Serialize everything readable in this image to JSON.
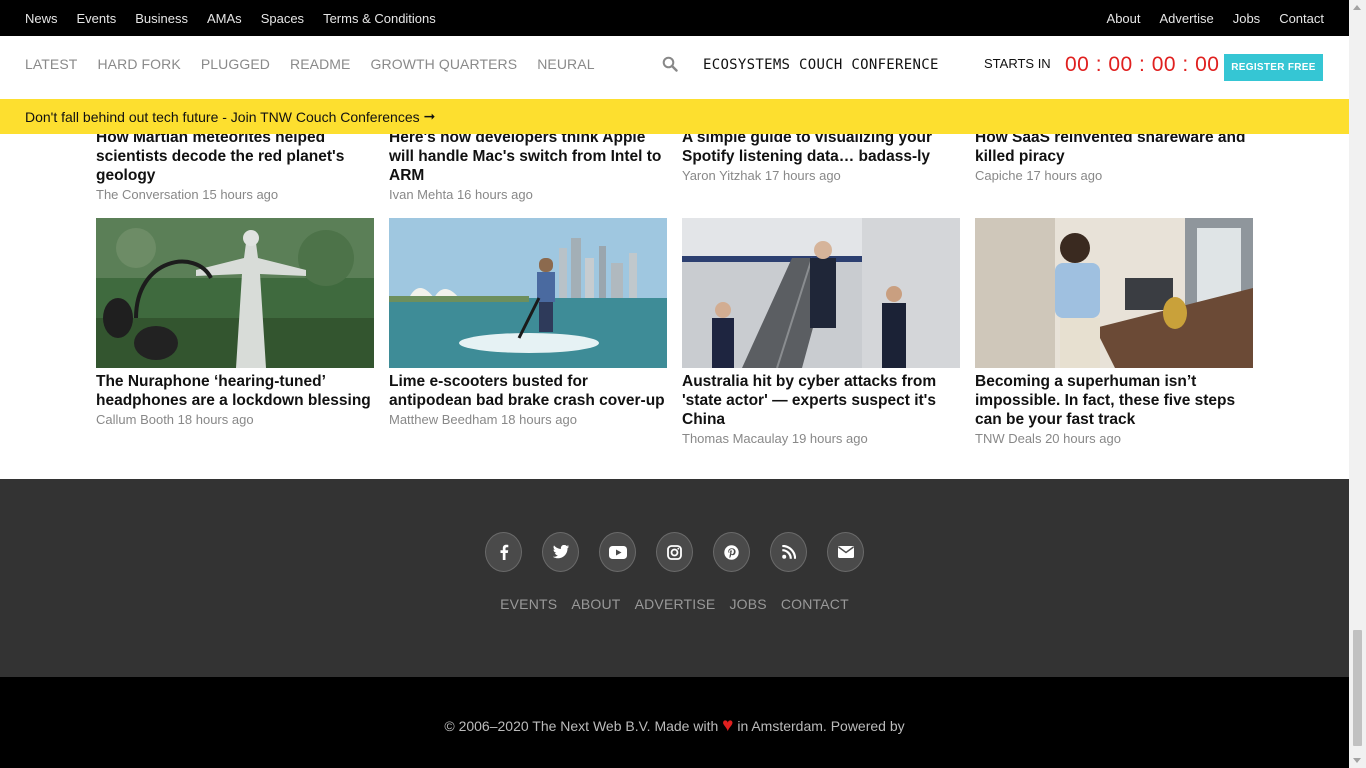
{
  "topbar": {
    "left": [
      "News",
      "Events",
      "Business",
      "AMAs",
      "Spaces",
      "Terms & Conditions"
    ],
    "right": [
      "About",
      "Advertise",
      "Jobs",
      "Contact"
    ]
  },
  "navbar": {
    "categories": [
      "LATEST",
      "HARD FORK",
      "PLUGGED",
      "README",
      "GROWTH QUARTERS",
      "NEURAL"
    ],
    "conference": "ECOSYSTEMS COUCH CONFERENCE",
    "starts_label": "STARTS IN",
    "countdown": "00 : 00 : 00 : 00",
    "register_label": "REGISTER FREE"
  },
  "banner": {
    "text": "Don't fall behind out tech future - Join TNW Couch Conferences",
    "arrow": "➞"
  },
  "articles_top": [
    {
      "title": "How Martian meteorites helped scientists decode the red planet's geology",
      "author": "The Conversation",
      "time": "15 hours ago"
    },
    {
      "title": "Here's how developers think Apple will handle Mac's switch from Intel to ARM",
      "author": "Ivan Mehta",
      "time": "16 hours ago"
    },
    {
      "title": "A simple guide to visualizing your Spotify listening data… badass-ly",
      "author": "Yaron Yitzhak",
      "time": "17 hours ago"
    },
    {
      "title": "How SaaS reinvented shareware and killed piracy",
      "author": "Capiche",
      "time": "17 hours ago"
    }
  ],
  "articles_bottom": [
    {
      "title": "The Nuraphone ‘hearing-tuned’ headphones are a lockdown blessing",
      "author": "Callum Booth",
      "time": "18 hours ago"
    },
    {
      "title": "Lime e-scooters busted for antipodean bad brake crash cover-up",
      "author": "Matthew Beedham",
      "time": "18 hours ago"
    },
    {
      "title": "Australia hit by cyber attacks from 'state actor' — experts suspect it's China",
      "author": "Thomas Macaulay",
      "time": "19 hours ago"
    },
    {
      "title": "Becoming a superhuman isn’t impossible. In fact, these five steps can be your fast track",
      "author": "TNW Deals",
      "time": "20 hours ago"
    }
  ],
  "footer": {
    "social_icons": [
      "facebook-icon",
      "twitter-icon",
      "youtube-icon",
      "instagram-icon",
      "pinterest-icon",
      "rss-icon",
      "mail-icon"
    ],
    "links": [
      "EVENTS",
      "ABOUT",
      "ADVERTISE",
      "JOBS",
      "CONTACT"
    ],
    "copyright_pre": "© 2006–2020 The Next Web B.V. Made with",
    "heart": "♥",
    "copyright_post": "in Amsterdam. Powered by"
  },
  "colors": {
    "accent_red": "#e0201f",
    "banner_yellow": "#fddf2f",
    "register_cyan": "#35c6d4"
  }
}
